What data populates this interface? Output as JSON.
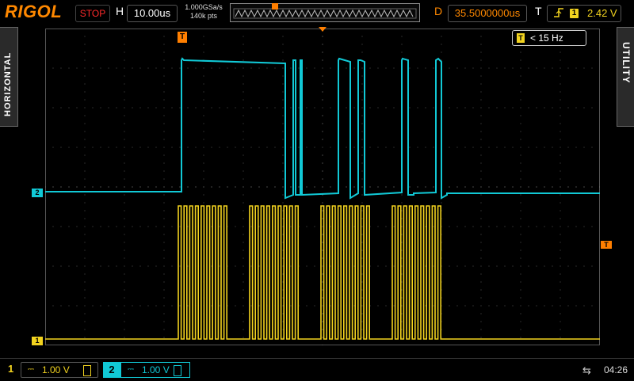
{
  "header": {
    "brand": "RIGOL",
    "run_state": "STOP",
    "h_label": "H",
    "timebase": "10.00us",
    "sample_rate": "1.000GSa/s",
    "memory_depth": "140k pts",
    "d_label": "D",
    "delay": "35.5000000us",
    "t_label": "T",
    "trigger_source": "1",
    "trigger_level": "2.42 V"
  },
  "side_tabs": {
    "left": "HORIZONTAL",
    "right": "UTILITY"
  },
  "screen": {
    "counter_source": "T",
    "counter_value": "< 15 Hz",
    "trigger_time_marker": "T",
    "trigger_level_marker": "T",
    "ch1_marker": "1",
    "ch2_marker": "2"
  },
  "channels": [
    {
      "number": "1",
      "coupling": "⎓",
      "scale": "1.00 V",
      "color": "#f2d31f"
    },
    {
      "number": "2",
      "coupling": "⎓",
      "scale": "1.00 V",
      "color": "#11c9d6"
    }
  ],
  "status": {
    "clock": "04:26"
  },
  "colors": {
    "ch1": "#f2d31f",
    "ch2": "#11c9d6",
    "accent": "#ff7f00",
    "stop": "#ff2a2a"
  }
}
